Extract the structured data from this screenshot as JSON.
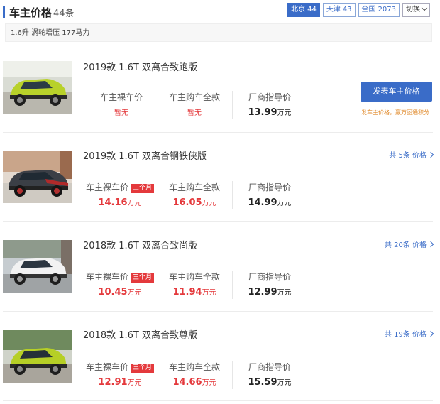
{
  "header": {
    "title": "车主价格",
    "count": "44条",
    "cities": [
      {
        "name": "北京",
        "count": "44"
      },
      {
        "name": "天津",
        "count": "43"
      },
      {
        "name": "全国",
        "count": "2073"
      }
    ],
    "switch_label": "切换"
  },
  "filter_text": "1.6升 涡轮增压 177马力",
  "labels": {
    "owner_bare": "车主裸车价",
    "owner_full": "车主购车全款",
    "msrp": "厂商指导价",
    "unit": "万元",
    "badge": "三个月"
  },
  "items": [
    {
      "model": "2019款 1.6T 双离合致跑版",
      "bare": "暂无",
      "full": "暂无",
      "msrp": "13.99",
      "button_label": "发表车主价格",
      "button_hint": "发车主价格，赢万图通积分"
    },
    {
      "model": "2019款 1.6T 双离合钢铁侠版",
      "bare": "14.16",
      "full": "16.05",
      "msrp": "14.99",
      "link_label": "共 5条 价格"
    },
    {
      "model": "2018款 1.6T 双离合致尚版",
      "bare": "10.45",
      "full": "11.94",
      "msrp": "12.99",
      "link_label": "共 20条 价格"
    },
    {
      "model": "2018款 1.6T 双离合致尊版",
      "bare": "12.91",
      "full": "14.66",
      "msrp": "15.59",
      "link_label": "共 19条 价格"
    }
  ],
  "colors": {
    "accent": "#3a6cc8",
    "price_red": "#e4393c",
    "hint_orange": "#e08a2b"
  }
}
